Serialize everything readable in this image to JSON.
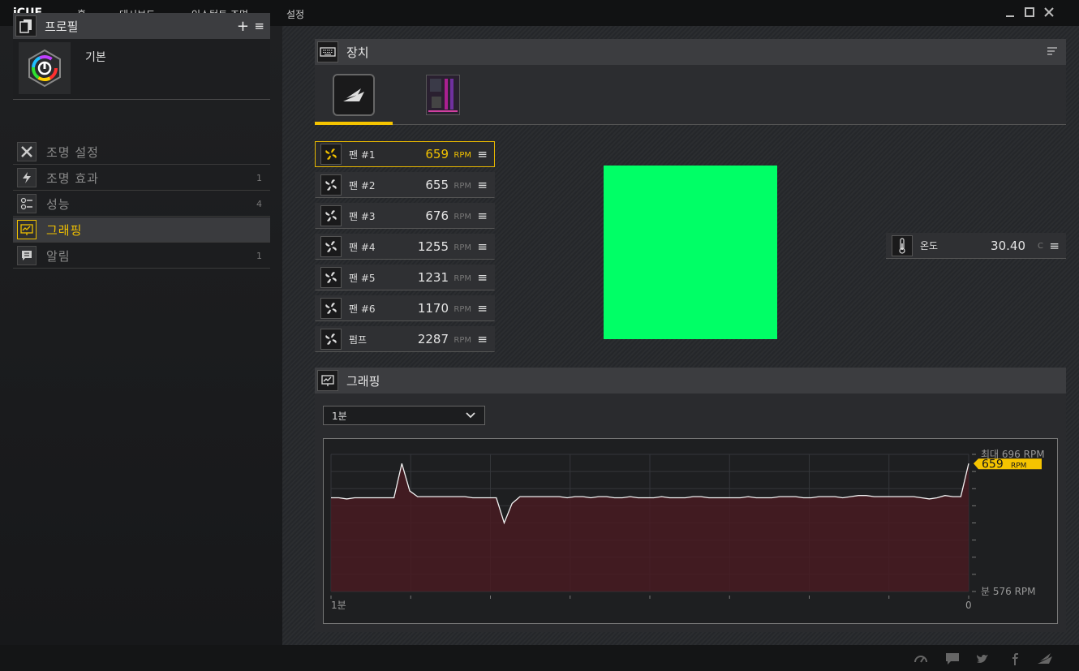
{
  "app": {
    "title": "iCUE"
  },
  "nav": {
    "items": [
      "홈",
      "대시보드",
      "인스턴트 조명",
      "설정"
    ]
  },
  "profile": {
    "header": "프로필",
    "name": "기본"
  },
  "menu": [
    {
      "label": "조명 설정",
      "count": ""
    },
    {
      "label": "조명 효과",
      "count": "1"
    },
    {
      "label": "성능",
      "count": "4"
    },
    {
      "label": "그래핑",
      "count": ""
    },
    {
      "label": "알림",
      "count": "1"
    }
  ],
  "devices": {
    "header": "장치"
  },
  "fans": [
    {
      "name": "팬 #1",
      "value": "659",
      "unit": "RPM"
    },
    {
      "name": "팬 #2",
      "value": "655",
      "unit": "RPM"
    },
    {
      "name": "팬 #3",
      "value": "676",
      "unit": "RPM"
    },
    {
      "name": "팬 #4",
      "value": "1255",
      "unit": "RPM"
    },
    {
      "name": "팬 #5",
      "value": "1231",
      "unit": "RPM"
    },
    {
      "name": "팬 #6",
      "value": "1170",
      "unit": "RPM"
    },
    {
      "name": "펌프",
      "value": "2287",
      "unit": "RPM"
    }
  ],
  "temperature": {
    "name": "온도",
    "value": "30.40",
    "unit": "C"
  },
  "swatch_color": "#00ff66",
  "accent_color": "#f5c400",
  "graph": {
    "header": "그래핑",
    "range": "1분",
    "max_label": "최대 696 RPM",
    "min_label": "분 576 RPM",
    "current_value": "659",
    "current_unit": "RPM",
    "x_start": "1분",
    "x_end": "0"
  },
  "chart_data": {
    "type": "area",
    "ylim": [
      576,
      696
    ],
    "series": [
      {
        "name": "팬 #1",
        "values": [
          658,
          658,
          657,
          658,
          658,
          658,
          658,
          658,
          658,
          688,
          664,
          659,
          659,
          659,
          659,
          659,
          659,
          659,
          658,
          658,
          658,
          658,
          636,
          653,
          659,
          659,
          659,
          659,
          659,
          659,
          658,
          659,
          659,
          658,
          659,
          659,
          658,
          658,
          659,
          658,
          658,
          658,
          659,
          658,
          658,
          658,
          659,
          659,
          658,
          658,
          658,
          658,
          658,
          659,
          658,
          658,
          658,
          659,
          659,
          659,
          658,
          658,
          659,
          659,
          659,
          658,
          659,
          660,
          660,
          659,
          659,
          659,
          659,
          659,
          659,
          658,
          657,
          658,
          660,
          659,
          659,
          688
        ]
      }
    ]
  }
}
